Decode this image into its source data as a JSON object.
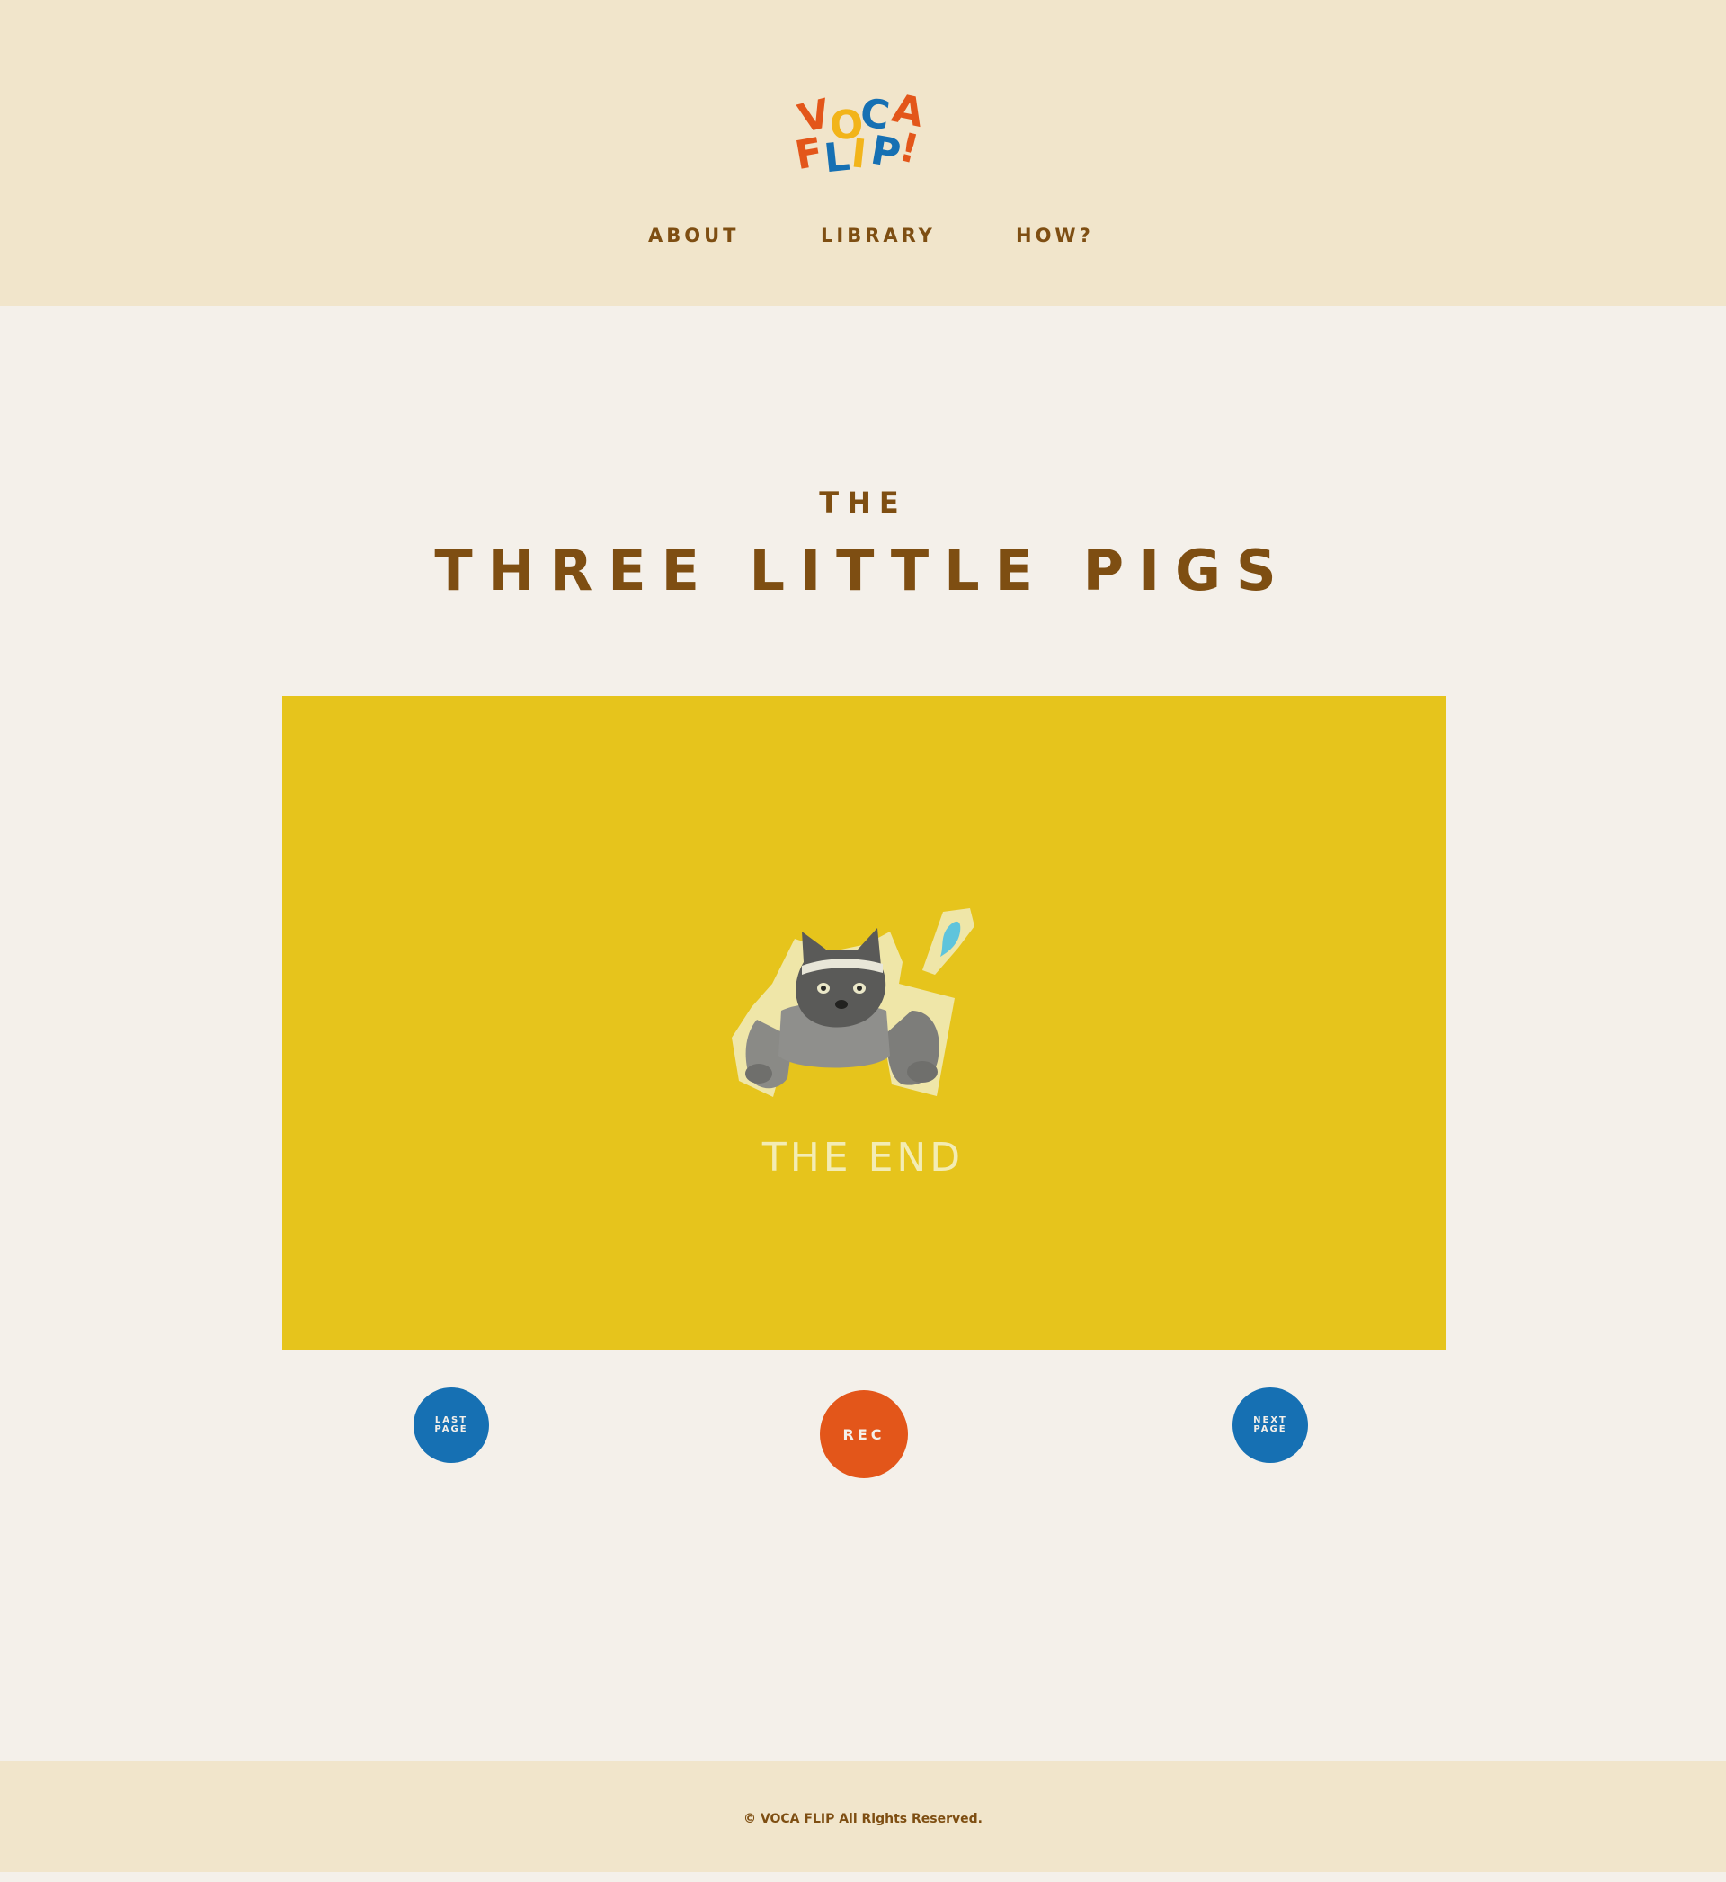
{
  "colors": {
    "header_bg": "#f1e5cb",
    "page_bg": "#f4f0ea",
    "text_brown": "#7e4e12",
    "stage_yellow": "#e6c41c",
    "button_blue": "#1670b3",
    "button_orange": "#e3561a"
  },
  "logo": {
    "row1": [
      "V",
      "O",
      "C",
      "A"
    ],
    "row2": [
      "F",
      "L",
      "I",
      "P",
      "!"
    ]
  },
  "nav": {
    "items": [
      {
        "label": "ABOUT"
      },
      {
        "label": "LIBRARY"
      },
      {
        "label": "HOW?"
      }
    ]
  },
  "story": {
    "title_small": "THE",
    "title_big": "THREE LITTLE PIGS",
    "page_text": "THE END"
  },
  "controls": {
    "last_line1": "LAST",
    "last_line2": "PAGE",
    "rec_label": "REC",
    "next_line1": "NEXT",
    "next_line2": "PAGE"
  },
  "footer": {
    "copyright": "© VOCA FLIP All  Rights Reserved."
  }
}
